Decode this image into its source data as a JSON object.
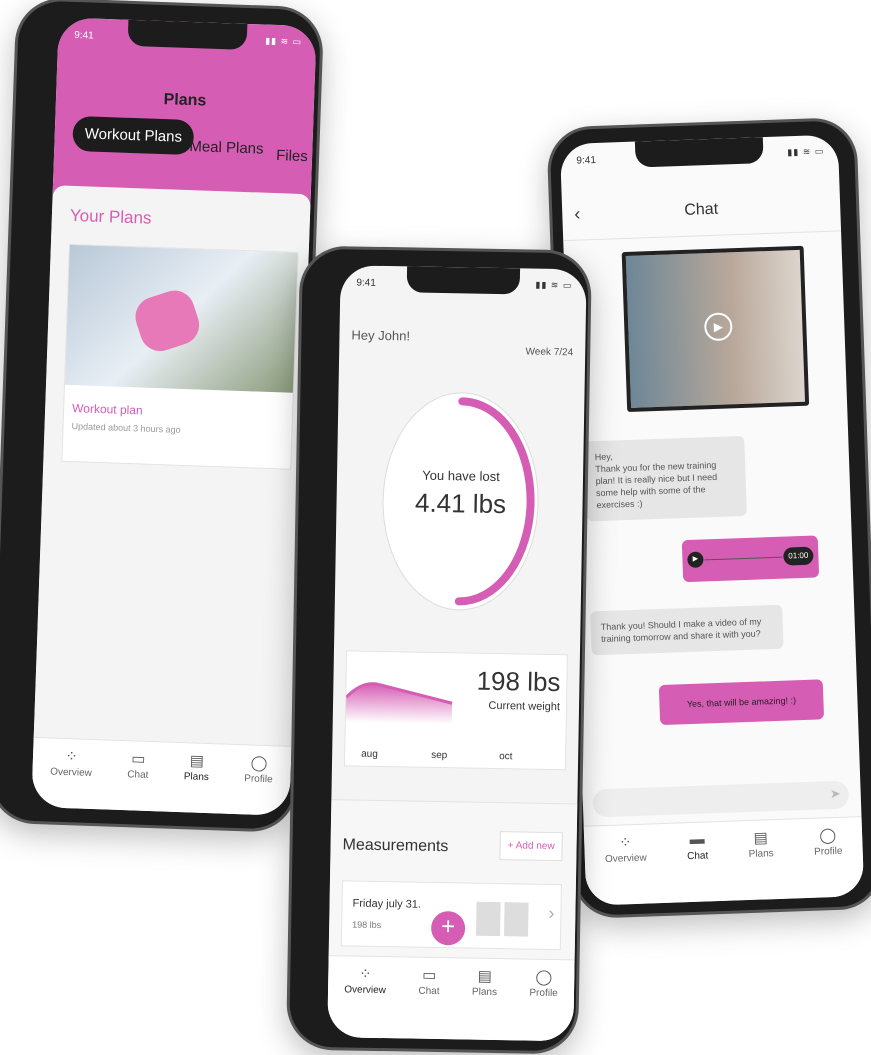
{
  "status_time": "9:41",
  "plans_screen": {
    "title": "Plans",
    "tabs": [
      "Workout Plans",
      "Meal Plans",
      "Files"
    ],
    "section_title": "Your Plans",
    "card": {
      "title": "Workout plan",
      "subtitle": "Updated about 3 hours ago"
    }
  },
  "overview_screen": {
    "greeting": "Hey John!",
    "week": "Week 7/24",
    "progress": {
      "label": "You have lost",
      "value": "4.41 lbs",
      "fraction": 0.5
    },
    "weight": {
      "value": "198 lbs",
      "label": "Current weight",
      "months": [
        "aug",
        "sep",
        "oct"
      ]
    },
    "measurements": {
      "title": "Measurements",
      "add_label": "+ Add new",
      "entry_date": "Friday july 31.",
      "entry_value": "198 lbs"
    },
    "fab": "+"
  },
  "chat_screen": {
    "title": "Chat",
    "messages": [
      {
        "from": "other",
        "text": "Hey,\nThank you for the new training plan! It is really nice but I need some help with some of the exercises :)"
      },
      {
        "from": "me",
        "type": "audio",
        "duration": "01:00"
      },
      {
        "from": "other",
        "text": "Thank you! Should I make a video of my training tomorrow and share it with you?"
      },
      {
        "from": "me",
        "text": "Yes, that will be amazing! :)"
      }
    ]
  },
  "tabbar": [
    "Overview",
    "Chat",
    "Plans",
    "Profile"
  ],
  "colors": {
    "accent": "#d65db4",
    "dark": "#1c1c1c"
  }
}
